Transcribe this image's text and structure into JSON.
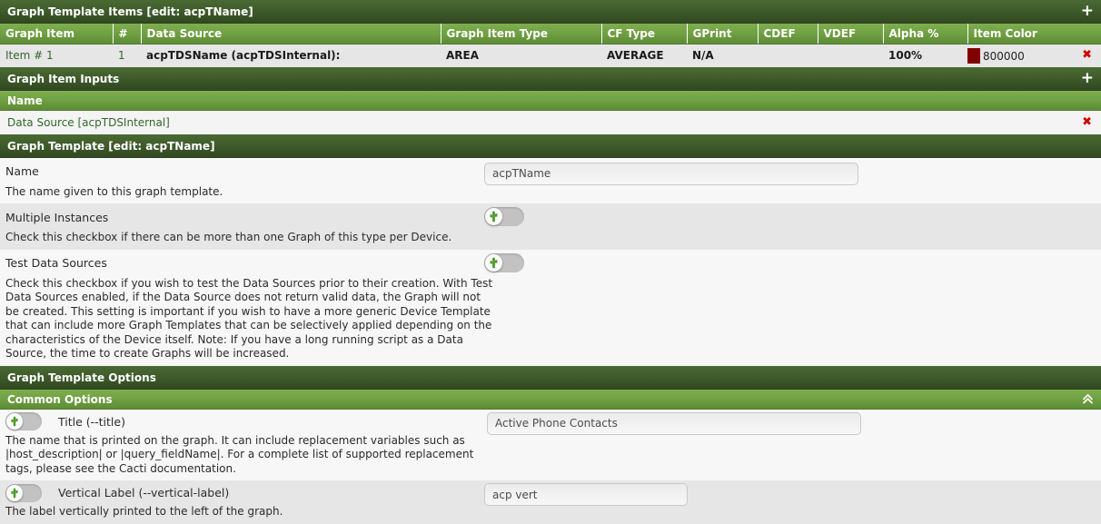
{
  "sections": {
    "graph_template_items": {
      "title": "Graph Template Items [edit: acpTName]",
      "add_icon": "plus-icon",
      "columns": [
        "Graph Item",
        "#",
        "Data Source",
        "Graph Item Type",
        "CF Type",
        "GPrint",
        "CDEF",
        "VDEF",
        "Alpha %",
        "Item Color"
      ],
      "rows": [
        {
          "graph_item": "Item # 1",
          "num": "1",
          "data_source": "acpTDSName (acpTDSInternal):",
          "graph_item_type": "AREA",
          "cf_type": "AVERAGE",
          "gprint": "N/A",
          "cdef": "",
          "vdef": "",
          "alpha": "100%",
          "item_color": "800000",
          "item_color_hex": "#800000",
          "delete_icon": "x-delete-icon"
        }
      ]
    },
    "graph_item_inputs": {
      "title": "Graph Item Inputs",
      "add_icon": "plus-icon",
      "column": "Name",
      "rows": [
        {
          "name": "Data Source [acpTDSInternal]",
          "delete_icon": "x-delete-icon"
        }
      ]
    },
    "graph_template": {
      "title": "Graph Template [edit: acpTName]",
      "fields": [
        {
          "label": "Name",
          "description": "The name given to this graph template.",
          "control": "text",
          "value": "acpTName",
          "placeholder": ""
        },
        {
          "label": "Multiple Instances",
          "description": "Check this checkbox if there can be more than one Graph of this type per Device.",
          "control": "toggle",
          "checked": false
        },
        {
          "label": "Test Data Sources",
          "description": "Check this checkbox if you wish to test the Data Sources prior to their creation. With Test Data Sources enabled, if the Data Source does not return valid data, the Graph will not be created. This setting is important if you wish to have a more generic Device Template that can include more Graph Templates that can be selectively applied depending on the characteristics of the Device itself. Note: If you have a long running script as a Data Source, the time to create Graphs will be increased.",
          "control": "toggle",
          "checked": false
        }
      ]
    },
    "graph_template_options": {
      "title": "Graph Template Options"
    },
    "common_options": {
      "title": "Common Options",
      "collapse_icon": "chevron-double-up-icon",
      "fields": [
        {
          "label": "Title (--title)",
          "description": "The name that is printed on the graph. It can include replacement variables such as |host_description| or |query_fieldName|. For a complete list of supported replacement tags, please see the Cacti documentation.",
          "value": "Active Phone Contacts",
          "toggle_checked": false
        },
        {
          "label": "Vertical Label (--vertical-label)",
          "description": "The label vertically printed to the left of the graph.",
          "value": "acp vert",
          "toggle_checked": false
        }
      ]
    }
  },
  "colors": {
    "bar_dark": "#3f5c2b",
    "bar_light": "#6fa042",
    "link_green": "#33682c",
    "delete_red": "#d40000",
    "item_color": "#800000"
  }
}
